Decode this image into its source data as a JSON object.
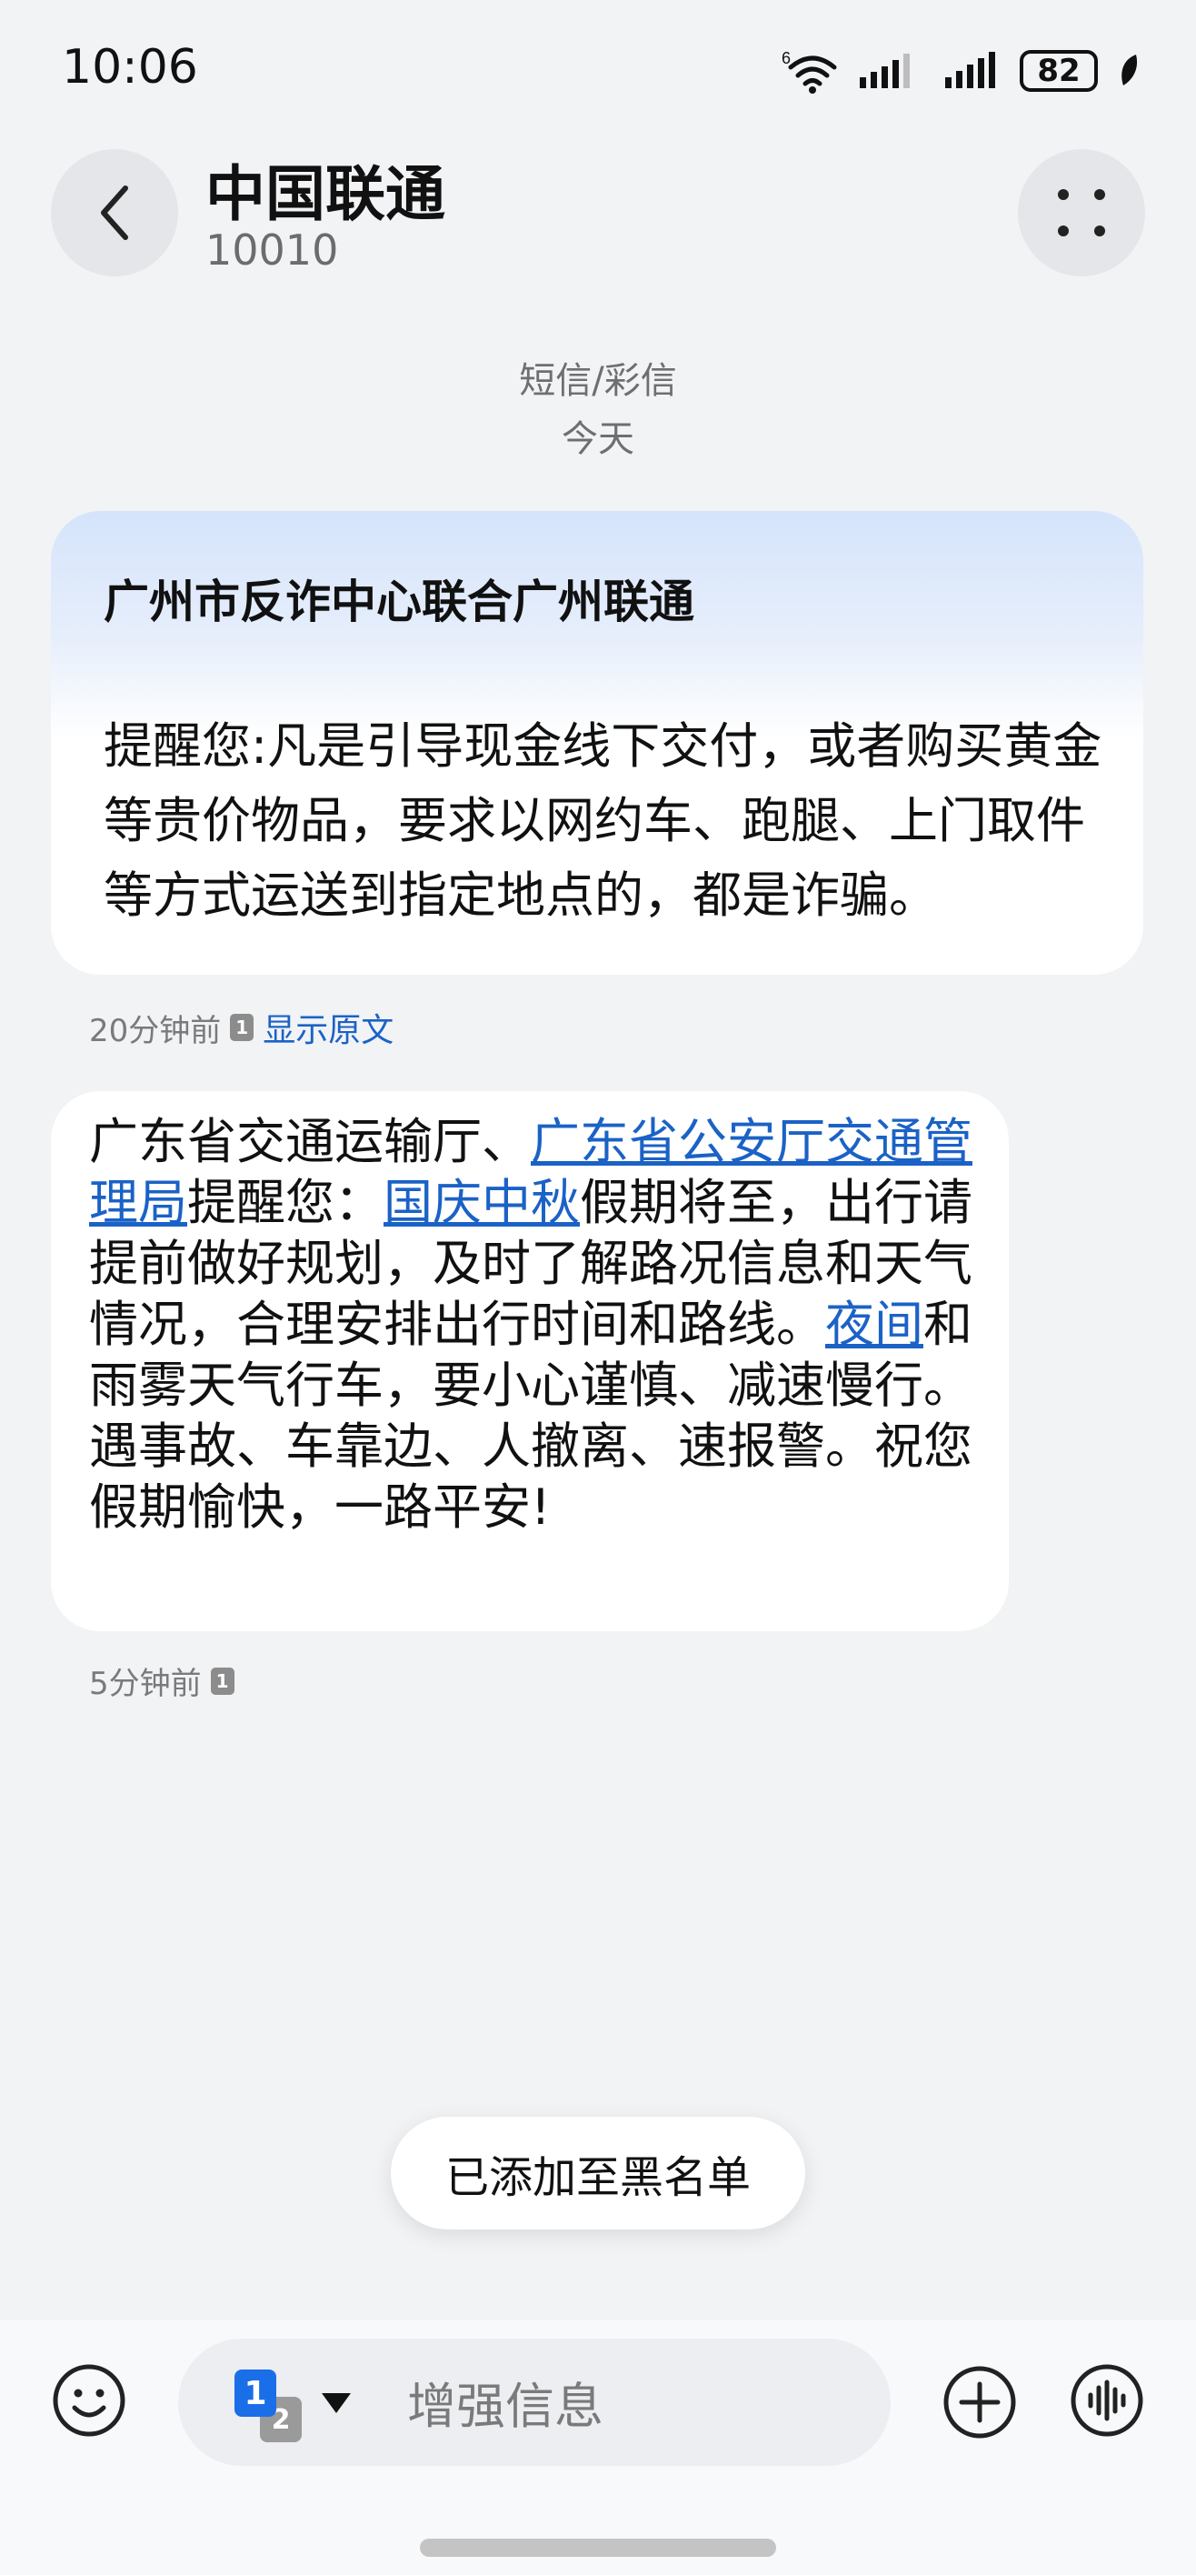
{
  "status_bar": {
    "time": "10:06",
    "wifi_tag": "6",
    "battery": "82",
    "icons": [
      "wifi-icon",
      "signal-icon",
      "signal-icon",
      "battery-icon",
      "leaf-icon"
    ]
  },
  "header": {
    "contact_name": "中国联通",
    "contact_number": "10010",
    "back_icon": "chevron-left-icon",
    "more_icon": "more-dots-icon"
  },
  "conversation": {
    "channel": "短信/彩信",
    "date": "今天"
  },
  "messages": [
    {
      "title": "广州市反诈中心联合广州联通",
      "body": "提醒您:凡是引导现金线下交付，或者购买黄金等贵价物品，要求以网约车、跑腿、上门取件等方式运送到指定地点的，都是诈骗。",
      "time": "20分钟前",
      "sim": "1",
      "show_original": "显示原文"
    },
    {
      "segments": [
        {
          "text": "广东省交通运输厅、",
          "link": false
        },
        {
          "text": "广东省公安厅交通管理局",
          "link": true
        },
        {
          "text": "提醒您：",
          "link": false
        },
        {
          "text": "国庆中秋",
          "link": true
        },
        {
          "text": "假期将至，出行请提前做好规划，及时了解路况信息和天气情况，合理安排出行时间和路线。",
          "link": false
        },
        {
          "text": "夜间",
          "link": true
        },
        {
          "text": "和雨雾天气行车，要小心谨慎、减速慢行。遇事故、车靠边、人撤离、速报警。祝您假期愉快，一路平安!",
          "link": false
        }
      ],
      "time": "5分钟前",
      "sim": "1"
    }
  ],
  "toast": "已添加至黑名单",
  "composer": {
    "placeholder": "增强信息",
    "sim_primary": "1",
    "sim_secondary": "2",
    "emoji_icon": "emoji-icon",
    "add_icon": "plus-circle-icon",
    "voice_icon": "voice-wave-icon"
  },
  "colors": {
    "link": "#1b62c6",
    "sim_primary": "#1a6ee8",
    "background": "#f1f3f5"
  }
}
